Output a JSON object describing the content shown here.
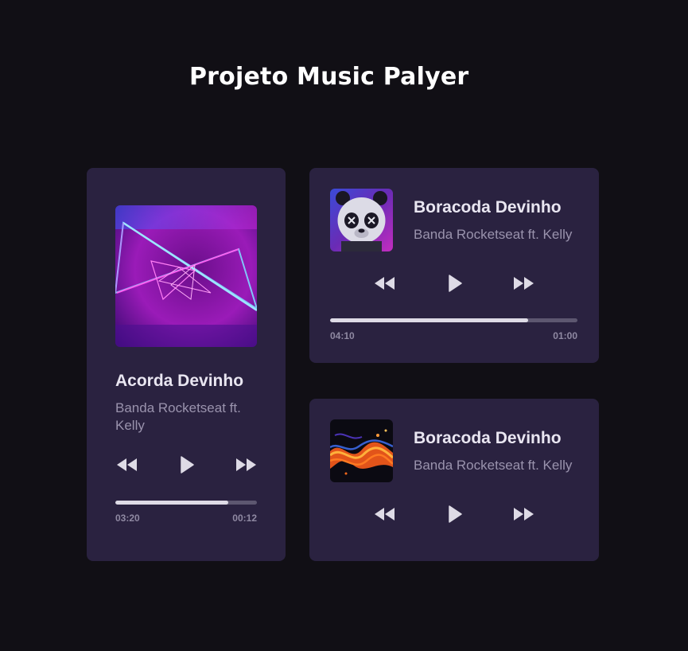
{
  "page": {
    "title": "Projeto Music Palyer"
  },
  "players": [
    {
      "cover_icon": "neon-triangles-album-art",
      "title": "Acorda Devinho",
      "artist": "Banda Rocketseat ft. Kelly",
      "elapsed": "03:20",
      "remaining": "00:12",
      "progress": 0.8
    },
    {
      "cover_icon": "panda-album-art",
      "title": "Boracoda Devinho",
      "artist": "Banda Rocketseat ft. Kelly",
      "elapsed": "04:10",
      "remaining": "01:00",
      "progress": 0.8
    },
    {
      "cover_icon": "fire-waves-album-art",
      "title": "Boracoda Devinho",
      "artist": "Banda Rocketseat ft. Kelly"
    }
  ],
  "controls": {
    "previous_icon": "rewind-icon",
    "play_icon": "play-icon",
    "next_icon": "fast-forward-icon"
  },
  "colors": {
    "background": "#110f15",
    "card": "#2a2240",
    "title": "#e9e6f1",
    "artist": "#9a93ad",
    "progress_fill": "#dedbe6",
    "progress_track": "#5d5770"
  }
}
